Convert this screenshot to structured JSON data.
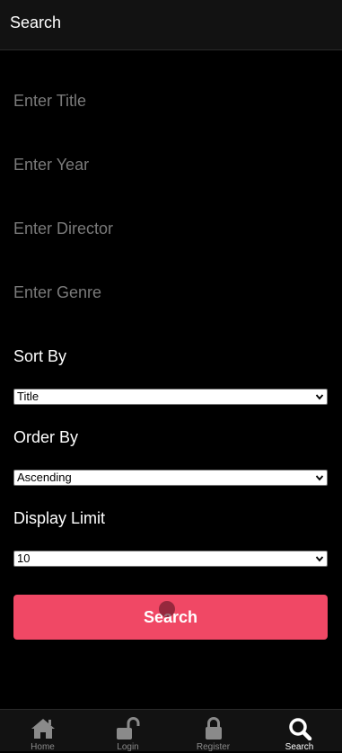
{
  "header": {
    "title": "Search"
  },
  "form": {
    "title_placeholder": "Enter Title",
    "year_placeholder": "Enter Year",
    "director_placeholder": "Enter Director",
    "genre_placeholder": "Enter Genre",
    "sort_by_label": "Sort By",
    "sort_by_value": "Title",
    "order_by_label": "Order By",
    "order_by_value": "Ascending",
    "display_limit_label": "Display Limit",
    "display_limit_value": "10",
    "search_button_label": "Search"
  },
  "tabs": [
    {
      "label": "Home",
      "icon": "home-icon",
      "active": false
    },
    {
      "label": "Login",
      "icon": "unlock-icon",
      "active": false
    },
    {
      "label": "Register",
      "icon": "lock-icon",
      "active": false
    },
    {
      "label": "Search",
      "icon": "search-icon",
      "active": true
    }
  ],
  "colors": {
    "background": "#000000",
    "header_background": "#121212",
    "accent": "#f04865",
    "placeholder": "#7a7a7a",
    "inactive_tab": "#8a8a8a",
    "active_tab": "#ffffff"
  }
}
